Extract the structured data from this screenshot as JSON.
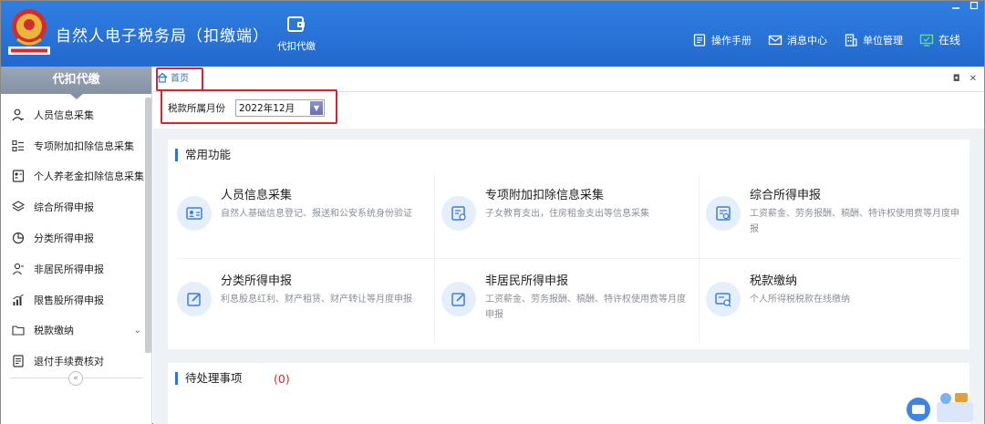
{
  "header": {
    "app_title": "自然人电子税务局（扣缴端）",
    "nav_tab": "代扣代缴",
    "links": [
      {
        "label": "操作手册",
        "icon": "book-icon"
      },
      {
        "label": "消息中心",
        "icon": "mail-icon"
      },
      {
        "label": "单位管理",
        "icon": "building-icon"
      },
      {
        "label": "在线",
        "icon": "monitor-icon"
      }
    ],
    "colors": {
      "bar": "#2a70d6",
      "accent": "#2f74d8",
      "highlight": "#d9242a"
    }
  },
  "sidebar": {
    "title": "代扣代缴",
    "items": [
      {
        "label": "人员信息采集",
        "icon": "person-icon"
      },
      {
        "label": "专项附加扣除信息采集",
        "icon": "list-icon"
      },
      {
        "label": "个人养老金扣除信息采集",
        "icon": "id-card-icon"
      },
      {
        "label": "综合所得申报",
        "icon": "layers-icon"
      },
      {
        "label": "分类所得申报",
        "icon": "pie-icon"
      },
      {
        "label": "非居民所得申报",
        "icon": "person-outline-icon"
      },
      {
        "label": "限售股所得申报",
        "icon": "bar-chart-icon"
      },
      {
        "label": "税款缴纳",
        "icon": "folder-icon"
      },
      {
        "label": "退付手续费核对",
        "icon": "document-icon"
      }
    ],
    "collapse_glyph": "«"
  },
  "content": {
    "home_tab": "首页",
    "filter_label": "税款所属月份",
    "month_value": "2022年12月",
    "common": {
      "title": "常用功能",
      "cards": [
        {
          "title": "人员信息采集",
          "desc": "自然人基础信息登记、报送和公安系统身份验证",
          "icon": "id-photo-icon"
        },
        {
          "title": "专项附加扣除信息采集",
          "desc": "子女教育支出，住房租金支出等信息采集",
          "icon": "form-edit-icon"
        },
        {
          "title": "综合所得申报",
          "desc": "工资薪金、劳务报酬、稿酬、特许权使用费等月度申报",
          "icon": "form-add-icon"
        },
        {
          "title": "分类所得申报",
          "desc": "利息股息红利、财产租赁、财产转让等月度申报",
          "icon": "edit-icon"
        },
        {
          "title": "非居民所得申报",
          "desc": "工资薪金、劳务报酬、稿酬、特许权使用费等月度申报",
          "icon": "edit-icon"
        },
        {
          "title": "税款缴纳",
          "desc": "个人所得税税款在线缴纳",
          "icon": "payment-icon"
        }
      ]
    },
    "pending": {
      "title": "待处理事项",
      "count": "(0)"
    }
  }
}
